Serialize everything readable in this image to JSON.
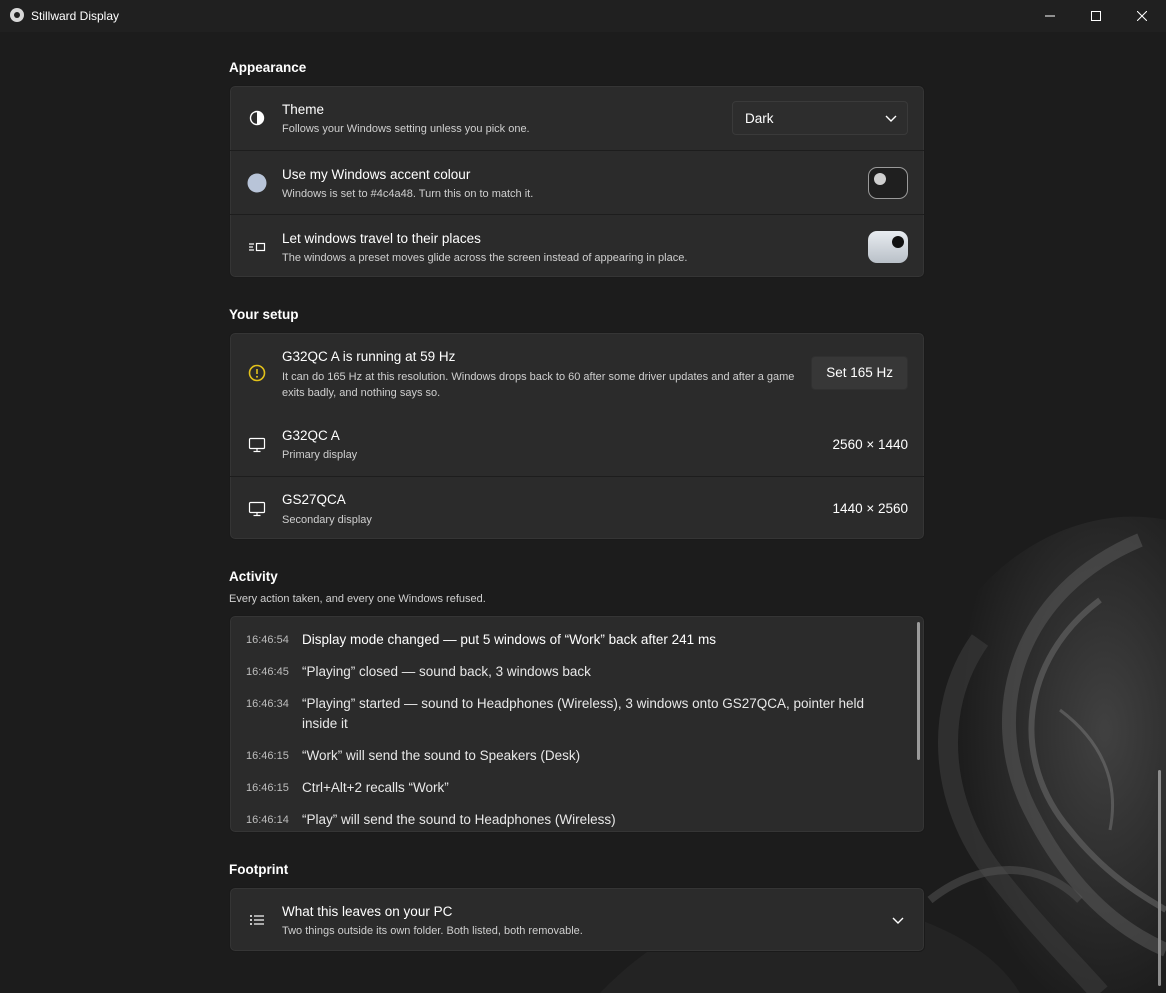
{
  "window": {
    "title": "Stillward Display"
  },
  "appearance": {
    "heading": "Appearance",
    "theme": {
      "title": "Theme",
      "description": "Follows your Windows setting unless you pick one.",
      "selected": "Dark"
    },
    "accent": {
      "title": "Use my Windows accent colour",
      "description": "Windows is set to #4c4a48. Turn this on to match it.",
      "enabled": false,
      "swatch_color": "#b8c4d8"
    },
    "travel": {
      "title": "Let windows travel to their places",
      "description": "The windows a preset moves glide across the screen instead of appearing in place.",
      "enabled": true
    }
  },
  "setup": {
    "heading": "Your setup",
    "warning": {
      "title": "G32QC A is running at 59 Hz",
      "description": "It can do 165 Hz at this resolution. Windows drops back to 60 after some driver updates and after a game exits badly, and nothing says so.",
      "button": "Set 165 Hz",
      "color": "#e3c21a"
    },
    "displays": [
      {
        "name": "G32QC A",
        "role": "Primary display",
        "resolution": "2560 × 1440"
      },
      {
        "name": "GS27QCA",
        "role": "Secondary display",
        "resolution": "1440 × 2560"
      }
    ]
  },
  "activity": {
    "heading": "Activity",
    "subtitle": "Every action taken, and every one Windows refused.",
    "entries": [
      {
        "time": "16:46:54",
        "text": "Display mode changed — put 5 windows of “Work” back after 241 ms"
      },
      {
        "time": "16:46:45",
        "text": "“Playing” closed — sound back, 3 windows back"
      },
      {
        "time": "16:46:34",
        "text": "“Playing” started — sound to Headphones (Wireless), 3 windows onto GS27QCA, pointer held inside it"
      },
      {
        "time": "16:46:15",
        "text": "“Work” will send the sound to Speakers (Desk)"
      },
      {
        "time": "16:46:15",
        "text": "Ctrl+Alt+2 recalls “Work”"
      },
      {
        "time": "16:46:14",
        "text": "“Play” will send the sound to Headphones (Wireless)"
      }
    ]
  },
  "footprint": {
    "heading": "Footprint",
    "title": "What this leaves on your PC",
    "description": "Two things outside its own folder. Both listed, both removable."
  }
}
